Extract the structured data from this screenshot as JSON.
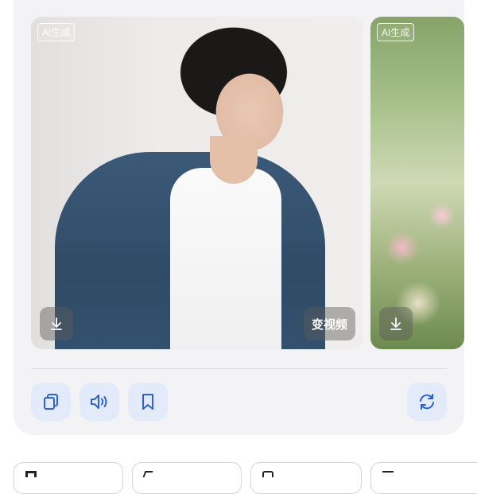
{
  "images": [
    {
      "badge": "AI生成",
      "video_label": "变视频"
    },
    {
      "badge": "AI生成"
    }
  ],
  "actions": {
    "copy": "copy-icon",
    "speak": "speaker-icon",
    "save": "bookmark-icon",
    "regenerate": "refresh-icon"
  },
  "colors": {
    "accent": "#2e62d8",
    "button_bg": "#e3eaf9",
    "card_bg": "#f3f3f5"
  }
}
